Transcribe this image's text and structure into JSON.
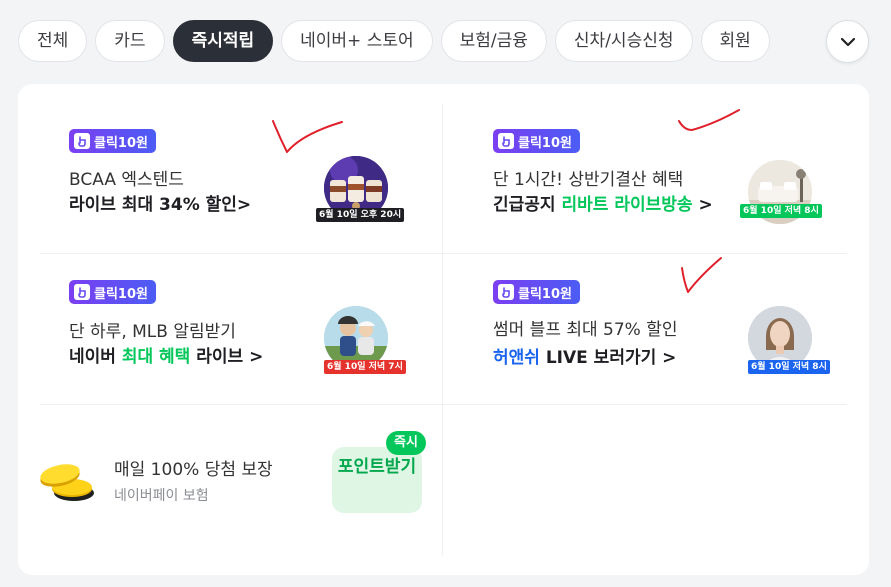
{
  "tabs": [
    {
      "label": "전체",
      "active": false
    },
    {
      "label": "카드",
      "active": false
    },
    {
      "label": "즉시적립",
      "active": true
    },
    {
      "label": "네이버+ 스토어",
      "active": false
    },
    {
      "label": "보험/금융",
      "active": false
    },
    {
      "label": "신차/시승신청",
      "active": false
    },
    {
      "label": "회원",
      "active": false
    }
  ],
  "more_button": {
    "icon": "chevron-down-icon"
  },
  "offers": [
    {
      "badge": "클릭10원",
      "line1": "BCAA 엑스텐드",
      "line2_parts": [
        {
          "text": "라이브 최대 34% 할인>",
          "color": "default"
        }
      ],
      "date_tag": "6월 10일 오후 20시",
      "date_tag_color": "#1e1e23",
      "thumbnail": "supplement-products"
    },
    {
      "badge": "클릭10원",
      "line1": "단 1시간! 상반기결산 혜택",
      "line2_parts": [
        {
          "text": "긴급공지 ",
          "color": "default"
        },
        {
          "text": "리바트 라이브방송",
          "color": "green"
        },
        {
          "text": " >",
          "color": "default"
        }
      ],
      "date_tag": "6월 10일 저녁 8시",
      "date_tag_color": "#03c75a",
      "thumbnail": "living-room-furniture"
    },
    {
      "badge": "클릭10원",
      "line1": "단 하루, MLB 알림받기",
      "line2_parts": [
        {
          "text": "네이버 ",
          "color": "default"
        },
        {
          "text": "최대 혜택",
          "color": "green"
        },
        {
          "text": " 라이브 >",
          "color": "default"
        }
      ],
      "date_tag": "6월 10일 저녁 7시",
      "date_tag_color": "#e5322d",
      "thumbnail": "cycling-couple"
    },
    {
      "badge": "클릭10원",
      "line1": "썸머 블프 최대 57% 할인",
      "line2_parts": [
        {
          "text": "허앤쉬",
          "color": "blue"
        },
        {
          "text": " LIVE 보러가기 >",
          "color": "default"
        }
      ],
      "date_tag": "6월 10일 저녁 8시",
      "date_tag_color": "#1a64f0",
      "thumbnail": "woman-portrait"
    }
  ],
  "point_offer": {
    "title": "매일 100% 당첨 보장",
    "subtitle": "네이버페이 보험",
    "button_label": "포인트받기",
    "instant_tag": "즉시",
    "icon": "gold-coins-icon"
  },
  "colors": {
    "green": "#03c75a",
    "blue": "#1a64f0",
    "badge": "#6a4cf3",
    "annotation": "#e0202a"
  }
}
